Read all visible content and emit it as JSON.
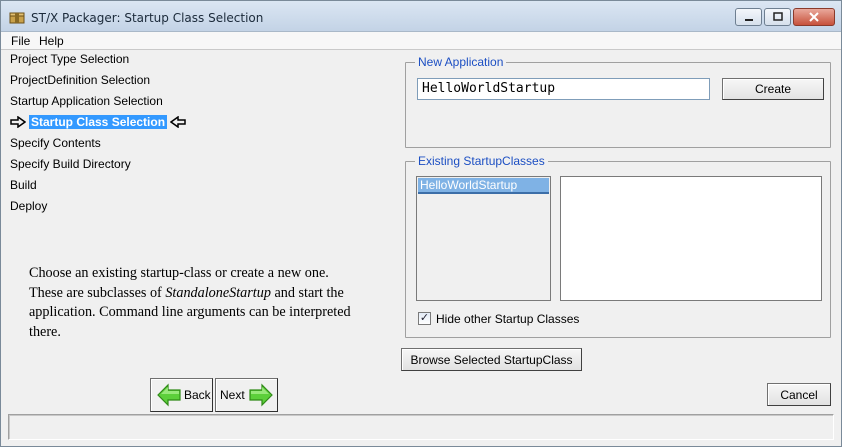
{
  "window": {
    "title": "ST/X Packager: Startup Class Selection"
  },
  "menu": [
    "File",
    "Help"
  ],
  "steps": [
    "Project Type Selection",
    "ProjectDefinition Selection",
    "Startup Application Selection",
    "Startup Class Selection",
    "Specify Contents",
    "Specify Build Directory",
    "Build",
    "Deploy"
  ],
  "current_step_index": 3,
  "description": {
    "line1": "Choose an existing startup-class or create a new one.",
    "line2_pre": "These are subclasses of ",
    "line2_em": "StandaloneStartup",
    "line2_post": " and start the",
    "line3": "application. Command line arguments can be interpreted",
    "line4": "there."
  },
  "new_application": {
    "group_title": "New Application",
    "name_value": "HelloWorldStartup",
    "create_label": "Create"
  },
  "existing": {
    "group_title": "Existing StartupClasses",
    "items": [
      "HelloWorldStartup"
    ],
    "hide_checkbox_label": "Hide other Startup Classes",
    "hide_checked": true
  },
  "browse_label": "Browse Selected StartupClass",
  "nav": {
    "back_label": "Back",
    "next_label": "Next",
    "cancel_label": "Cancel"
  },
  "icons": {
    "app": "package-icon",
    "back": "green-left-arrow-icon",
    "next": "green-right-arrow-icon"
  }
}
